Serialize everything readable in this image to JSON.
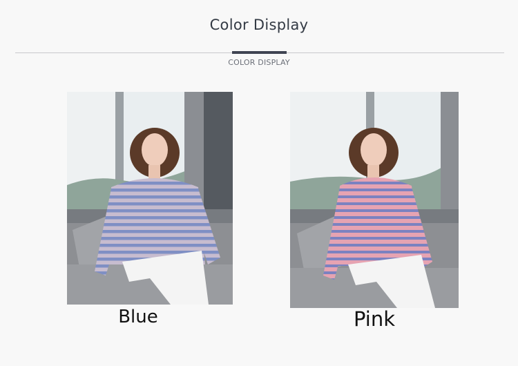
{
  "header": {
    "title": "Color Display",
    "subtitle": "COLOR DISPLAY"
  },
  "products": [
    {
      "caption": "Blue",
      "stripe_color": "#7f8fc4",
      "base_color": "#c9b9cf"
    },
    {
      "caption": "Pink",
      "stripe_color": "#7b82c0",
      "base_color": "#e6a3b2"
    }
  ],
  "colors": {
    "background": "#f8f8f8",
    "title_text": "#333a44",
    "accent_bar": "#3f4452",
    "rule": "#c8c8cc"
  }
}
